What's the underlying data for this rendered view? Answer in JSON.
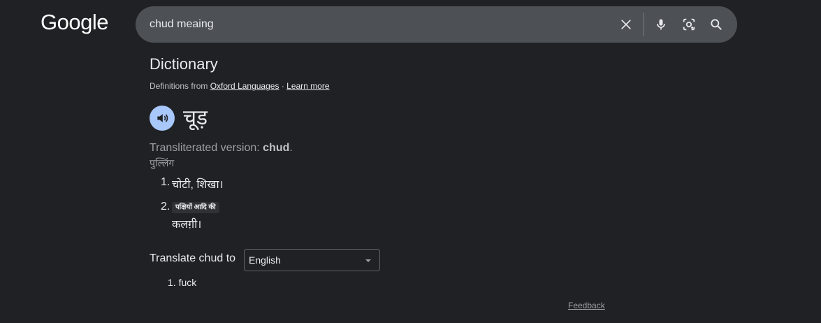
{
  "header": {
    "logo_text": "Google"
  },
  "search": {
    "query": "chud meaing",
    "icons": [
      "clear-icon",
      "mic-icon",
      "lens-icon",
      "search-icon"
    ]
  },
  "dictionary": {
    "title": "Dictionary",
    "source_prefix": "Definitions from",
    "source_link": "Oxford Languages",
    "separator": "·",
    "learn_more": "Learn more",
    "headword": "चूड़",
    "translit_prefix": "Transliterated version:",
    "translit_word": "chud",
    "translit_suffix": ".",
    "part_of_speech": "पुल्लिंग",
    "definitions": [
      {
        "num": "1.",
        "text": "चोटी, शिखा।"
      },
      {
        "num": "2.",
        "tag": "पक्षियों आदि की",
        "text": "कलग़ी।"
      }
    ]
  },
  "translate": {
    "label": "Translate chud to",
    "selected_language": "English",
    "results": [
      {
        "num": "1.",
        "text": "fuck"
      }
    ]
  },
  "footer": {
    "feedback": "Feedback"
  },
  "colors": {
    "background": "#202124",
    "search_bg": "#4d5156",
    "speaker_accent": "#a8c7fa",
    "text_primary": "#e8eaed",
    "text_secondary": "#9aa0a6"
  }
}
